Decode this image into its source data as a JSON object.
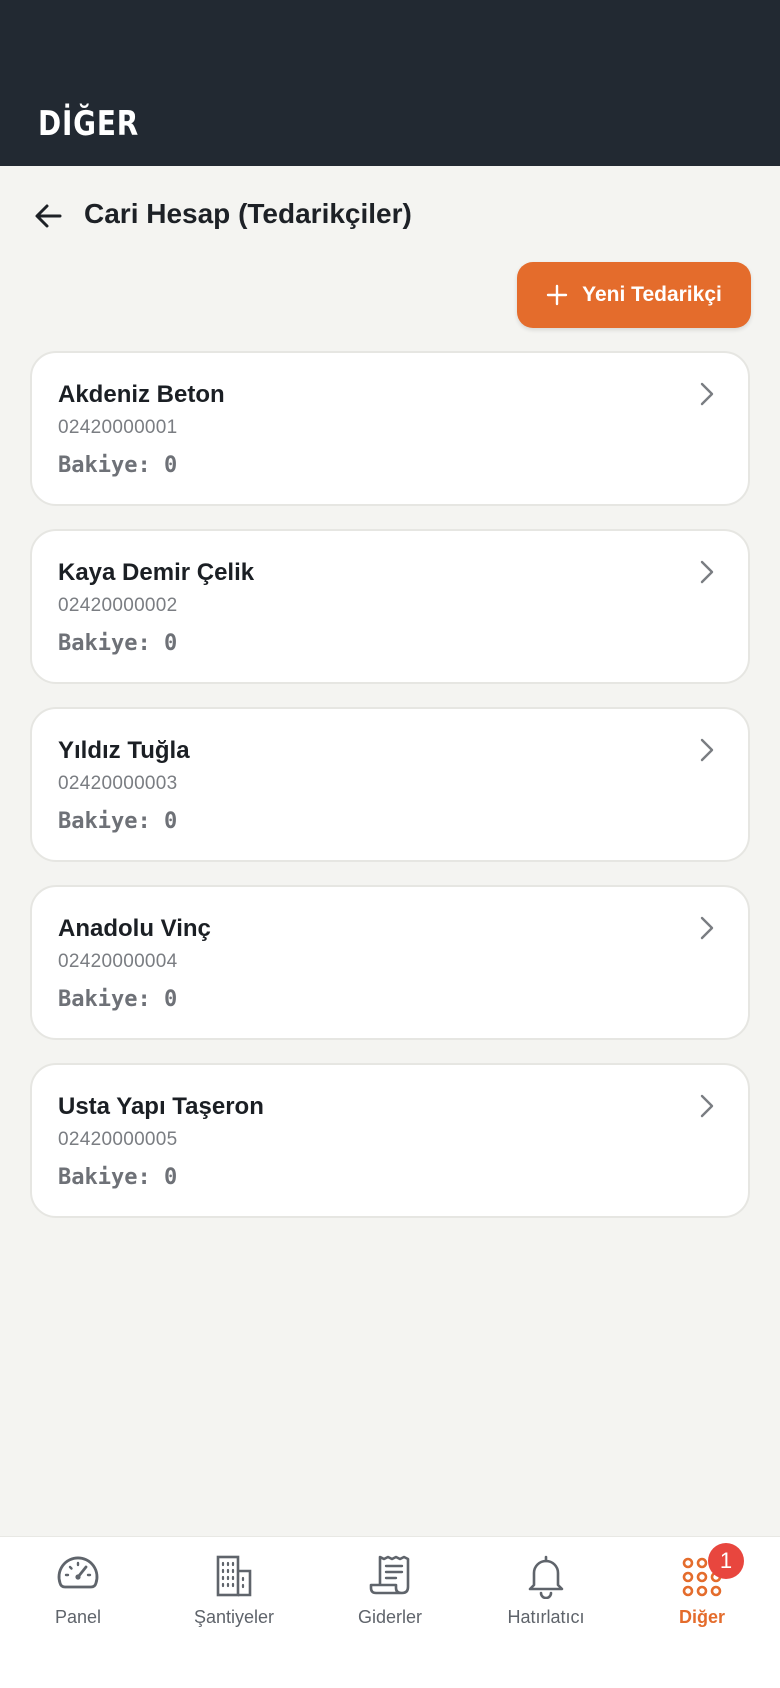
{
  "app_bar": {
    "title": "DİĞER"
  },
  "page": {
    "title": "Cari Hesap (Tedarikçiler)"
  },
  "actions": {
    "new_supplier_label": "Yeni Tedarikçi"
  },
  "suppliers": [
    {
      "name": "Akdeniz Beton",
      "phone": "02420000001",
      "balance": "Bakiye: 0"
    },
    {
      "name": "Kaya Demir Çelik",
      "phone": "02420000002",
      "balance": "Bakiye: 0"
    },
    {
      "name": "Yıldız Tuğla",
      "phone": "02420000003",
      "balance": "Bakiye: 0"
    },
    {
      "name": "Anadolu Vinç",
      "phone": "02420000004",
      "balance": "Bakiye: 0"
    },
    {
      "name": "Usta Yapı Taşeron",
      "phone": "02420000005",
      "balance": "Bakiye: 0"
    }
  ],
  "bottom_nav": {
    "items": [
      {
        "label": "Panel",
        "icon": "speedometer-icon"
      },
      {
        "label": "Şantiyeler",
        "icon": "building-icon"
      },
      {
        "label": "Giderler",
        "icon": "receipt-icon"
      },
      {
        "label": "Hatırlatıcı",
        "icon": "bell-icon"
      },
      {
        "label": "Diğer",
        "icon": "grid-dots-icon",
        "badge": "1",
        "active": true
      }
    ]
  },
  "colors": {
    "accent": "#e46c2c",
    "app_bar": "#222932",
    "background": "#f4f4f1",
    "badge": "#e8463e"
  }
}
